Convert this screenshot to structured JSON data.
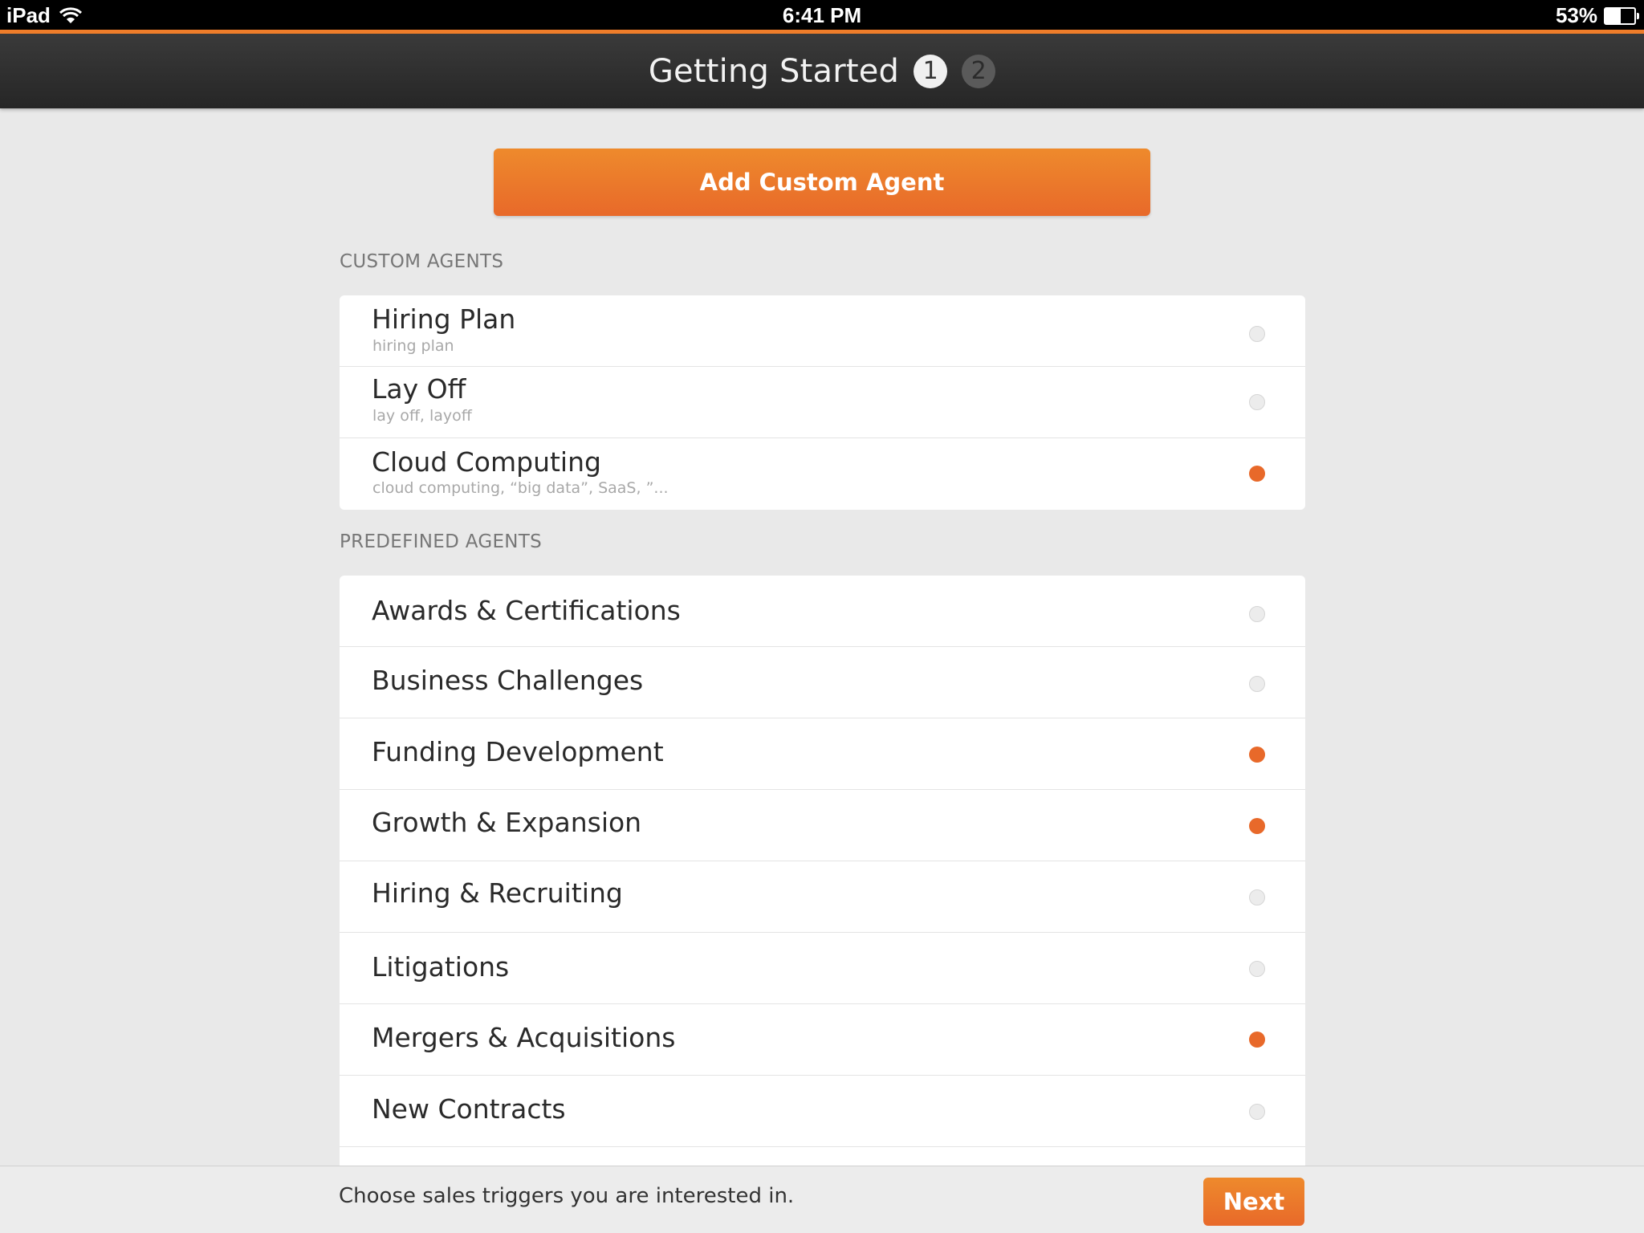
{
  "status_bar": {
    "device": "iPad",
    "time": "6:41 PM",
    "battery": "53%",
    "battery_level": 0.53,
    "wifi_icon": "wifi-icon",
    "battery_icon": "battery-icon"
  },
  "nav": {
    "title": "Getting Started",
    "step_1": "1",
    "step_2": "2"
  },
  "add_button_label": "Add Custom Agent",
  "custom_section": {
    "header": "CUSTOM AGENTS",
    "items": [
      {
        "title": "Hiring Plan",
        "subtitle": "hiring plan",
        "selected": false
      },
      {
        "title": "Lay Off",
        "subtitle": "lay off, layoff",
        "selected": false
      },
      {
        "title": "Cloud Computing",
        "subtitle": "cloud computing, “big data”,  SaaS, ”...",
        "selected": true
      }
    ]
  },
  "predefined_section": {
    "header": "PREDEFINED AGENTS",
    "items": [
      {
        "title": "Awards & Certifications",
        "selected": false
      },
      {
        "title": "Business Challenges",
        "selected": false
      },
      {
        "title": "Funding Development",
        "selected": true
      },
      {
        "title": "Growth & Expansion",
        "selected": true
      },
      {
        "title": "Hiring & Recruiting",
        "selected": false
      },
      {
        "title": "Litigations",
        "selected": false
      },
      {
        "title": "Mergers & Acquisitions",
        "selected": true
      },
      {
        "title": "New Contracts",
        "selected": false
      }
    ]
  },
  "footer": {
    "hint": "Choose sales triggers you are interested in.",
    "next_label": "Next"
  },
  "colors": {
    "accent": "#e8692a",
    "nav_bg": "#2e2e2e",
    "page_bg": "#e9e9e9"
  }
}
